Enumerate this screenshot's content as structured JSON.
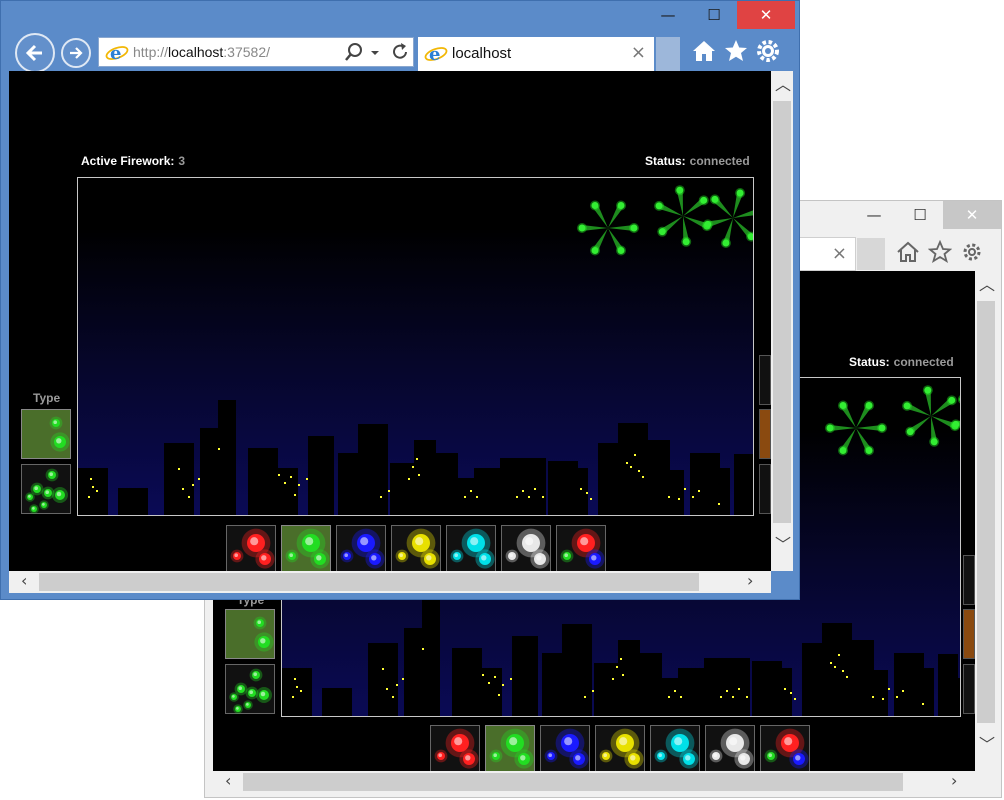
{
  "browser": {
    "address_prefix": "http://",
    "address_host": "localhost",
    "address_port": ":37582/",
    "tab_title": "localhost",
    "tab_close": "×",
    "caption": {
      "minimize": "—",
      "maximize": "☐",
      "close": "✕"
    }
  },
  "page": {
    "active_label": "Active Firework:",
    "active_value": "3",
    "status_label": "Status:",
    "status_value": "connected",
    "type_label": "Type"
  },
  "colors": {
    "red": "#ff2020",
    "green": "#22dd22",
    "blue": "#1a1aff",
    "yellow": "#e8e000",
    "cyan": "#00e0e8",
    "white": "#e8e8e8",
    "accent_selected": "#4a6e2a"
  },
  "color_palette": [
    {
      "name": "red",
      "primary": "#ff2020",
      "secondary": "#ff2020"
    },
    {
      "name": "green",
      "primary": "#22dd22",
      "secondary": "#22dd22",
      "selected": true
    },
    {
      "name": "blue",
      "primary": "#1a1aff",
      "secondary": "#1a1aff"
    },
    {
      "name": "yellow",
      "primary": "#e8e000",
      "secondary": "#e8e000"
    },
    {
      "name": "cyan",
      "primary": "#00e0e8",
      "secondary": "#00e0e8"
    },
    {
      "name": "white",
      "primary": "#e8e8e8",
      "secondary": "#e8e8e8"
    },
    {
      "name": "mixed",
      "primary": "#ff2020",
      "secondary": "#1a1aff"
    }
  ],
  "types": [
    {
      "name": "burst",
      "selected": true
    },
    {
      "name": "cluster",
      "selected": false
    }
  ]
}
